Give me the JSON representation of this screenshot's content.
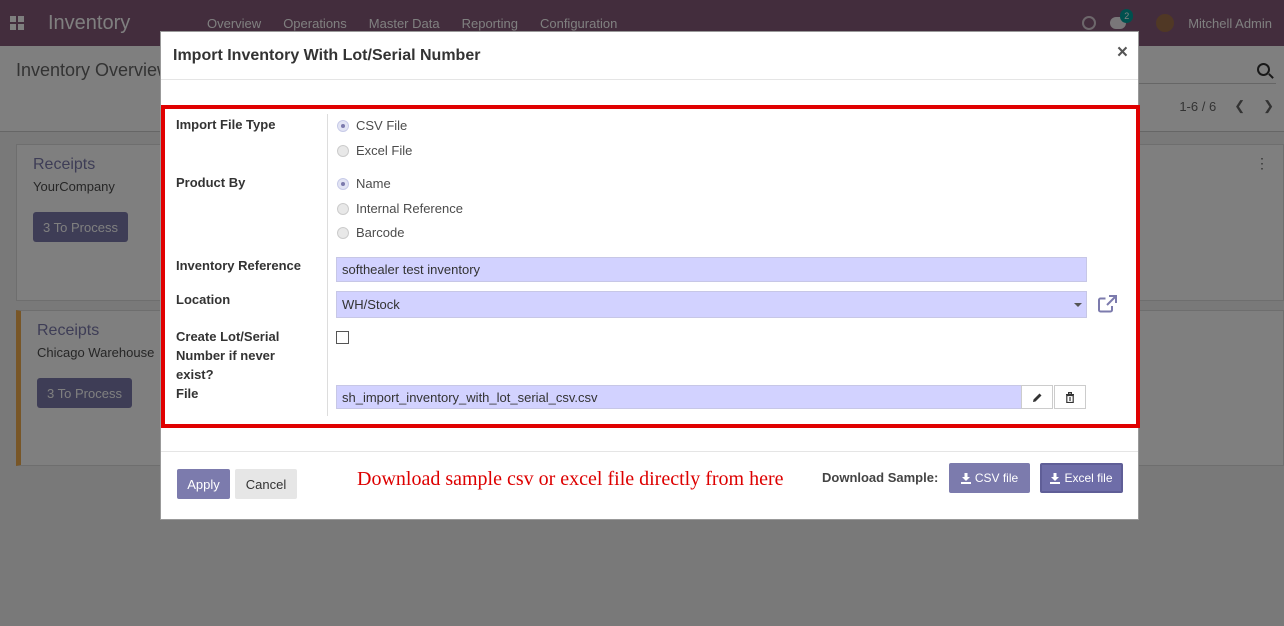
{
  "app": {
    "brand": "Inventory",
    "menu": [
      "Overview",
      "Operations",
      "Master Data",
      "Reporting",
      "Configuration"
    ],
    "chat_count": "2",
    "user_name": "Mitchell Admin"
  },
  "control_panel": {
    "title": "Inventory Overview",
    "pager": "1-6 / 6"
  },
  "cards": [
    {
      "title": "Receipts",
      "company": "YourCompany",
      "button": "3 To Process"
    },
    {
      "title": "Receipts",
      "company": "Chicago Warehouse",
      "button": "3 To Process"
    }
  ],
  "modal": {
    "title": "Import Inventory With Lot/Serial Number",
    "close": "×",
    "labels": {
      "file_type": "Import File Type",
      "product_by": "Product By",
      "inventory_ref": "Inventory Reference",
      "location": "Location",
      "create_lot_1": "Create Lot/Serial",
      "create_lot_2": "Number if never",
      "create_lot_3": "exist?",
      "file": "File"
    },
    "file_type_options": [
      {
        "label": "CSV File",
        "selected": true
      },
      {
        "label": "Excel File",
        "selected": false
      }
    ],
    "product_by_options": [
      {
        "label": "Name",
        "selected": true
      },
      {
        "label": "Internal Reference",
        "selected": false
      },
      {
        "label": "Barcode",
        "selected": false
      }
    ],
    "inventory_reference_value": "softhealer test inventory",
    "location_value": "WH/Stock",
    "create_lot_checked": false,
    "file_value": "sh_import_inventory_with_lot_serial_csv.csv"
  },
  "footer": {
    "apply": "Apply",
    "cancel": "Cancel",
    "note": "Download sample csv or excel file directly from here",
    "download_label": "Download Sample:",
    "csv_button": "CSV file",
    "excel_button": "Excel file"
  },
  "colors": {
    "navbar": "#875a7b",
    "primary": "#7c7bad",
    "highlight_border": "#e00000",
    "note_text": "#dd0000",
    "field_bg": "#d2d2ff"
  }
}
